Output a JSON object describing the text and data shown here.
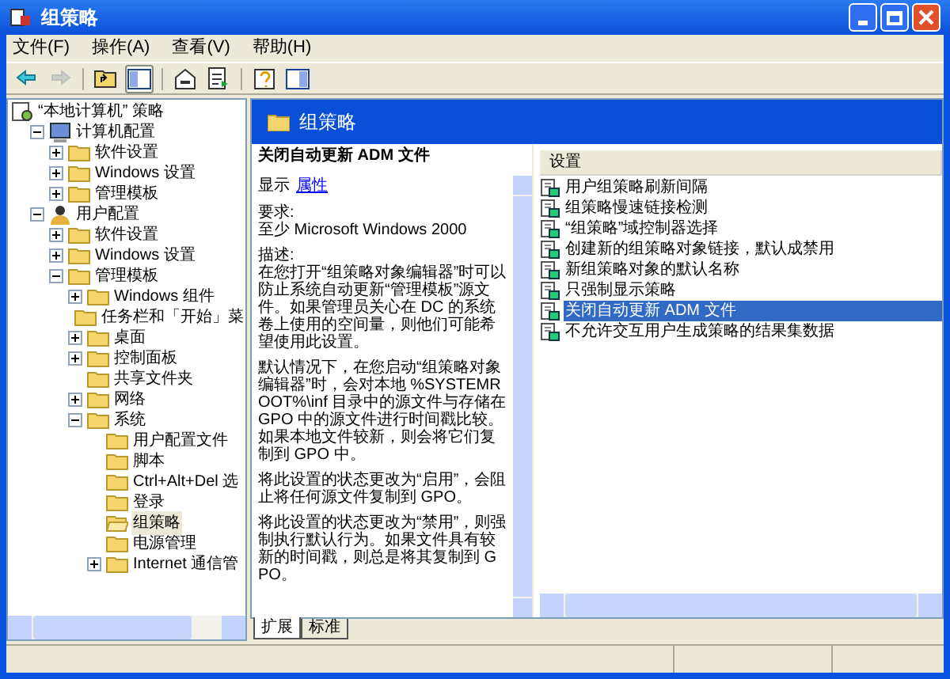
{
  "window": {
    "title": "组策略"
  },
  "menu": [
    {
      "label": "文件(F)"
    },
    {
      "label": "操作(A)"
    },
    {
      "label": "查看(V)"
    },
    {
      "label": "帮助(H)"
    }
  ],
  "toolbar": [
    {
      "kind": "back",
      "disabled": false,
      "pressed": false
    },
    {
      "kind": "forward",
      "disabled": true,
      "pressed": false
    },
    {
      "kind": "up",
      "disabled": false,
      "pressed": false
    },
    {
      "kind": "tree",
      "disabled": false,
      "pressed": true
    },
    {
      "kind": "properties",
      "disabled": false,
      "pressed": false
    },
    {
      "kind": "export",
      "disabled": false,
      "pressed": false
    },
    {
      "kind": "help",
      "disabled": false,
      "pressed": false
    },
    {
      "kind": "pane",
      "disabled": false,
      "pressed": false
    }
  ],
  "tree": [
    {
      "label": "“本地计算机” 策略",
      "kind": "policy",
      "selected": false,
      "children": [
        {
          "label": "计算机配置",
          "kind": "computer",
          "expanded": true,
          "selected": false,
          "children": [
            {
              "label": "软件设置",
              "kind": "folder",
              "expanded": false,
              "selected": false
            },
            {
              "label": "Windows 设置",
              "kind": "folder",
              "expanded": false,
              "selected": false
            },
            {
              "label": "管理模板",
              "kind": "folder",
              "expanded": false,
              "selected": false
            }
          ]
        },
        {
          "label": "用户配置",
          "kind": "user",
          "expanded": true,
          "selected": false,
          "children": [
            {
              "label": "软件设置",
              "kind": "folder",
              "expanded": false,
              "selected": false
            },
            {
              "label": "Windows 设置",
              "kind": "folder",
              "expanded": false,
              "selected": false
            },
            {
              "label": "管理模板",
              "kind": "folder",
              "expanded": true,
              "selected": false,
              "children": [
                {
                  "label": "Windows 组件",
                  "kind": "folder",
                  "expanded": false,
                  "selected": false
                },
                {
                  "label": "任务栏和「开始」菜",
                  "kind": "folder",
                  "selected": false
                },
                {
                  "label": "桌面",
                  "kind": "folder",
                  "expanded": false,
                  "selected": false
                },
                {
                  "label": "控制面板",
                  "kind": "folder",
                  "expanded": false,
                  "selected": false
                },
                {
                  "label": "共享文件夹",
                  "kind": "folder",
                  "selected": false
                },
                {
                  "label": "网络",
                  "kind": "folder",
                  "expanded": false,
                  "selected": false
                },
                {
                  "label": "系统",
                  "kind": "folder",
                  "expanded": true,
                  "selected": false,
                  "children": [
                    {
                      "label": "用户配置文件",
                      "kind": "folder",
                      "selected": false
                    },
                    {
                      "label": "脚本",
                      "kind": "folder",
                      "selected": false
                    },
                    {
                      "label": "Ctrl+Alt+Del 选",
                      "kind": "folder",
                      "selected": false
                    },
                    {
                      "label": "登录",
                      "kind": "folder",
                      "selected": false
                    },
                    {
                      "label": "组策略",
                      "kind": "folder",
                      "selected": true
                    },
                    {
                      "label": "电源管理",
                      "kind": "folder",
                      "selected": false
                    },
                    {
                      "label": "Internet 通信管",
                      "kind": "folder",
                      "expanded": false,
                      "selected": false
                    }
                  ]
                }
              ]
            }
          ]
        }
      ]
    }
  ],
  "header": {
    "title": "组策略"
  },
  "description": {
    "title": "关闭自动更新 ADM 文件",
    "show_label": "显示",
    "link": "属性",
    "blocks": [
      {
        "heading": "要求:",
        "text": "至少 Microsoft Windows 2000"
      },
      {
        "heading": "描述:",
        "text": "在您打开“组策略对象编辑器”时可以防止系统自动更新“管理模板”源文件。如果管理员关心在 DC 的系统卷上使用的空间量，则他们可能希望使用此设置。"
      },
      {
        "text": "默认情况下，在您启动“组策略对象编辑器”时，会对本地 %SYSTEMROOT%\\inf 目录中的源文件与存储在 GPO 中的源文件进行时间戳比较。如果本地文件较新，则会将它们复制到 GPO 中。"
      },
      {
        "text": "将此设置的状态更改为“启用”，会阻止将任何源文件复制到 GPO。"
      },
      {
        "text": "将此设置的状态更改为“禁用”，则强制执行默认行为。如果文件具有较新的时间戳，则总是将其复制到 GPO。"
      }
    ]
  },
  "list": {
    "columns": [
      "设置"
    ],
    "rows": [
      {
        "label": "用户组策略刷新间隔",
        "selected": false
      },
      {
        "label": "组策略慢速链接检测",
        "selected": false
      },
      {
        "label": "“组策略”域控制器选择",
        "selected": false
      },
      {
        "label": "创建新的组策略对象链接，默认成禁用",
        "selected": false
      },
      {
        "label": "新组策略对象的默认名称",
        "selected": false
      },
      {
        "label": "只强制显示策略",
        "selected": false
      },
      {
        "label": "关闭自动更新 ADM 文件",
        "selected": true
      },
      {
        "label": "不允许交互用户生成策略的结果集数据",
        "selected": false
      }
    ]
  },
  "tabs": [
    {
      "label": "扩展",
      "selected": true
    },
    {
      "label": "标准",
      "selected": false
    }
  ]
}
